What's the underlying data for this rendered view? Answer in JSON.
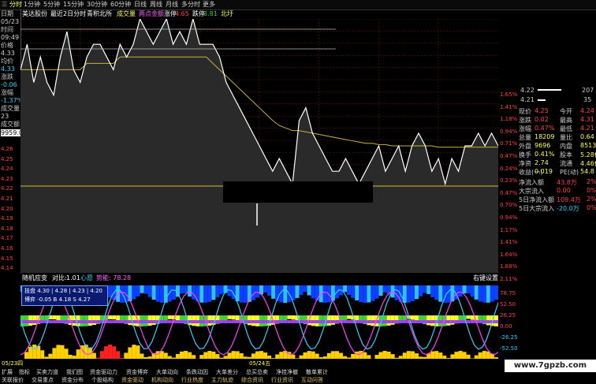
{
  "toolbar": {
    "tabs": [
      "分时",
      "1分钟",
      "5分钟",
      "15分钟",
      "30分钟",
      "60分钟",
      "日线",
      "周线",
      "月线",
      "多分时",
      "更多"
    ],
    "active_tab": "分时"
  },
  "infobar": {
    "name": "美达股份",
    "items": [
      "最近2日分时",
      "青积北所",
      "成交量",
      "两点金额",
      "涨停",
      "4.65",
      "跌停",
      "3.81",
      "北圩"
    ]
  },
  "left_panel": {
    "date_label": "日期",
    "date_value": "05/23",
    "time_label": "时间",
    "time_value": "09:49",
    "price_label": "价格",
    "price_value": "4.33",
    "avg_label": "均价",
    "avg_value": "4.33",
    "change_label": "涨跌",
    "change_value": "-0.06",
    "pct_label": "涨幅",
    "pct_value": "-1.37%",
    "vol_label": "成交量",
    "vol_value": "23",
    "amt_label": "成交额",
    "amt_value": "9959.0"
  },
  "price_axis": [
    "4.26",
    "4.25",
    "4.24",
    "4.23",
    "4.22",
    "4.21",
    "4.20",
    "4.19",
    "4.18",
    "4.17",
    "4.16",
    "4.15",
    "4.14"
  ],
  "pct_axis": [
    "1.65%",
    "1.41%",
    "1.18%",
    "0.94%",
    "0.71%",
    "0.47%",
    "0.24%",
    "0.23%",
    "0.47%",
    "0.70%",
    "0.94%",
    "1.17%",
    "1.41%",
    "1.64%",
    "1.88%",
    "2.11%"
  ],
  "quote": {
    "rows_top": [
      {
        "p": "4.22",
        "v": "207"
      },
      {
        "p": "4.21",
        "v": "35"
      }
    ],
    "grid": [
      [
        "现价",
        "4.25",
        "今开",
        "4.24"
      ],
      [
        "涨跌",
        "0.02",
        "最高",
        "4.31"
      ],
      [
        "涨幅",
        "0.47%",
        "最低",
        "4.21"
      ],
      [
        "总量",
        "18209",
        "量比",
        "0.64"
      ],
      [
        "外盘",
        "9696",
        "内盘",
        "8513"
      ],
      [
        "换手",
        "0.41%",
        "股本",
        "5.28亿"
      ],
      [
        "净资",
        "2.74",
        "流通",
        "4.46亿"
      ],
      [
        "收益(一)",
        "0.019",
        "PE(动)",
        "54.8"
      ]
    ],
    "flows": [
      [
        "净流入额",
        "43.8万",
        "2%"
      ],
      [
        "大宗流入",
        "0.00",
        "0%"
      ],
      [
        "5日净流入额",
        "109.4万",
        "2%"
      ],
      [
        "5日大宗流入",
        "-20.0万",
        "0%"
      ]
    ]
  },
  "indicator": {
    "title": "随机应变",
    "contrast_label": "对比:",
    "contrast_value": "1.01",
    "mood_label": "心愿",
    "mood_value": "势能: 78.28",
    "setting": "右键设置",
    "tooltip_line1": "技盘 4.30 | 4.28 | 4.23 | 4.20",
    "tooltip_line2": "博弈 -0.05  B  4.18  S  4.27",
    "axis": [
      "78.75",
      "52.50",
      "26.25",
      "0.00",
      "-26.25",
      "-52.50"
    ]
  },
  "bottom": {
    "dates": [
      "05/23四",
      "05/24五"
    ],
    "tabs1": [
      "扩展",
      "指标",
      "买卖力道",
      "我们图",
      "资金驱动力",
      "资金博弈",
      "大单动向",
      "条跌动因",
      "大单差分",
      "总买总卖",
      "净挂净撤",
      "散单累计"
    ],
    "tabs2": [
      "关联报价",
      "交易重点",
      "资金分布",
      "个股结构",
      "资金驱动",
      "机构动向",
      "行业热度",
      "主力轨迹",
      "综合资讯",
      "行业资讯",
      "互动问答"
    ]
  },
  "watermark": "www.7gpzb.com",
  "colors": {
    "price_line": "#ffffff",
    "avg_line": "#c9b23a",
    "up": "#ff4040",
    "down": "#30d0ff",
    "grid": "#7a1a1a"
  },
  "chart_data": {
    "type": "line",
    "series": [
      {
        "values": [
          4.3,
          4.32,
          4.29,
          4.31,
          4.29,
          4.28,
          4.31,
          4.33,
          4.3,
          4.29,
          4.31,
          4.32,
          4.32,
          4.31,
          4.3,
          4.32,
          4.31,
          4.32,
          4.34,
          4.33,
          4.32,
          4.33,
          4.34,
          4.32,
          4.33,
          4.32,
          4.34,
          4.32,
          4.32,
          4.32,
          4.31,
          4.29,
          4.28,
          4.27,
          4.26,
          4.25,
          4.24,
          4.23,
          4.22,
          4.23,
          4.22,
          4.21,
          4.26,
          4.27,
          4.25,
          4.24,
          4.23,
          4.22,
          4.22,
          4.23,
          4.22,
          4.21,
          4.22,
          4.23,
          4.24,
          4.22,
          4.23,
          4.24,
          4.22,
          4.24,
          4.25,
          4.24,
          4.22,
          4.23,
          4.21,
          4.23,
          4.22,
          4.24,
          4.24,
          4.25,
          4.24,
          4.25,
          4.24
        ]
      },
      {
        "values": [
          4.3,
          4.3,
          4.3,
          4.3,
          4.3,
          4.3,
          4.3,
          4.3,
          4.3,
          4.3,
          4.305,
          4.305,
          4.305,
          4.305,
          4.305,
          4.31,
          4.31,
          4.31,
          4.31,
          4.31,
          4.31,
          4.31,
          4.31,
          4.31,
          4.31,
          4.31,
          4.31,
          4.31,
          4.31,
          4.305,
          4.3,
          4.295,
          4.29,
          4.285,
          4.28,
          4.275,
          4.27,
          4.265,
          4.26,
          4.256,
          4.254,
          4.252,
          4.252,
          4.251,
          4.25,
          4.249,
          4.248,
          4.247,
          4.246,
          4.245,
          4.244,
          4.243,
          4.242,
          4.242,
          4.241,
          4.241,
          4.24,
          4.24,
          4.24,
          4.24,
          4.24,
          4.24,
          4.24,
          4.239,
          4.239,
          4.239,
          4.239,
          4.239,
          4.239,
          4.239,
          4.239,
          4.239,
          4.239
        ]
      }
    ],
    "ylim": [
      4.14,
      4.34
    ],
    "grid": true
  }
}
